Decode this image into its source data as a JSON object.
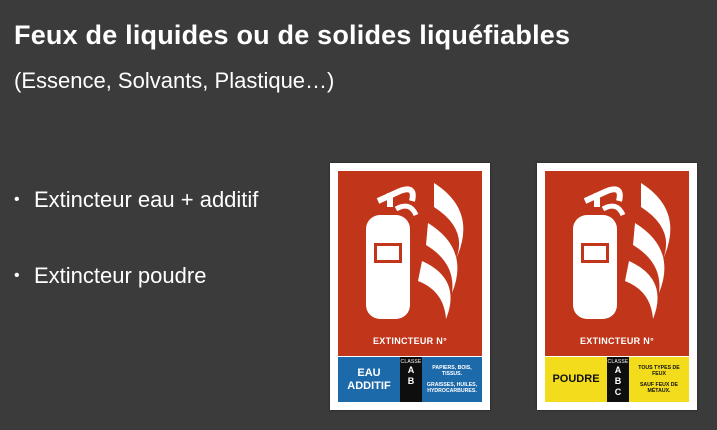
{
  "slide": {
    "title": "Feux de liquides ou de solides liquéfiables",
    "subtitle": "(Essence, Solvants, Plastique…)"
  },
  "bullets": [
    {
      "marker": "•",
      "text": "Extincteur eau + additif"
    },
    {
      "marker": "•",
      "text": "Extincteur poudre"
    }
  ],
  "signs": [
    {
      "label": "EXTINCTEUR N°",
      "agent_line1": "EAU",
      "agent_line2": "ADDITIF",
      "classe_label": "CLASSE",
      "classes": [
        "A",
        "B"
      ],
      "desc_top": "PAPIERS, BOIS, TISSUS.",
      "desc_bottom": "GRAISSES, HUILES, HYDROCARBURES.",
      "color": "#1d6aab",
      "icon": "fire-extinguisher-icon"
    },
    {
      "label": "EXTINCTEUR N°",
      "agent_line1": "POUDRE",
      "agent_line2": "",
      "classe_label": "CLASSE",
      "classes": [
        "A",
        "B",
        "C"
      ],
      "desc_top": "TOUS TYPES DE FEUX",
      "desc_bottom": "SAUF FEUX DE MÉTAUX.",
      "color": "#f3dc1c",
      "icon": "fire-extinguisher-icon"
    }
  ],
  "colors": {
    "background": "#3b3b3b",
    "sign_red": "#c1361b"
  }
}
